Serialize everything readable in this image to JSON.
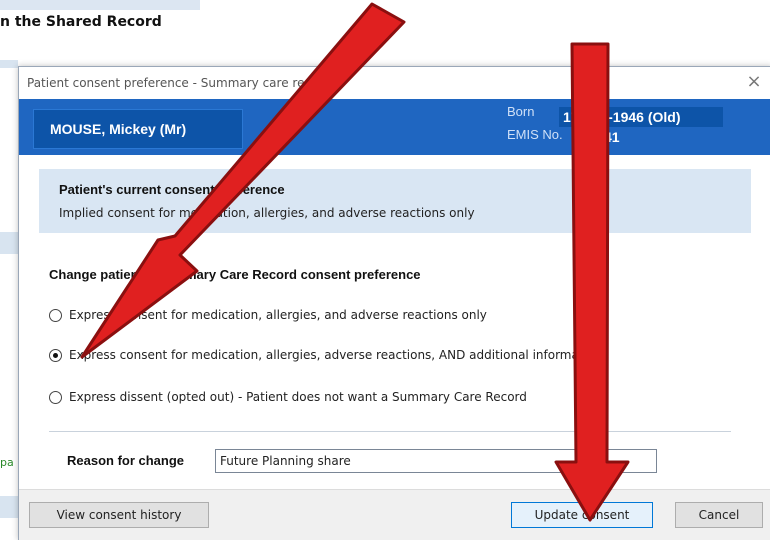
{
  "background": {
    "title_fragment": "n the Shared Record",
    "side_fragment": "pa"
  },
  "dialog": {
    "title": "Patient consent preference - Summary care record",
    "close_glyph": "×"
  },
  "patient": {
    "name": "MOUSE, Mickey (Mr)",
    "born_label": "Born",
    "dob": "17-Mar-1946 (Old)",
    "emis_label": "EMIS No.",
    "emis_no": "41"
  },
  "current_preference": {
    "heading": "Patient's current consent preference",
    "value": "Implied consent for medication, allergies, and adverse reactions only"
  },
  "change": {
    "heading": "Change patient's Summary Care Record consent preference",
    "options": [
      {
        "label": "Express consent for medication, allergies, and adverse reactions only",
        "selected": false
      },
      {
        "label": "Express consent for medication, allergies, adverse reactions, AND additional information",
        "selected": true
      },
      {
        "label": "Express dissent (opted out) - Patient does not want a Summary Care Record",
        "selected": false
      }
    ]
  },
  "reason": {
    "label": "Reason for change",
    "value": "Future Planning share"
  },
  "buttons": {
    "history": "View consent history",
    "update": "Update consent",
    "cancel": "Cancel"
  },
  "colors": {
    "patient_band": "#1f66c1",
    "arrow_fill": "#e02020",
    "arrow_outline": "#8a0f0f"
  },
  "annotations": {
    "arrows": [
      "arrow-to-selected-option",
      "arrow-to-update-button"
    ]
  }
}
